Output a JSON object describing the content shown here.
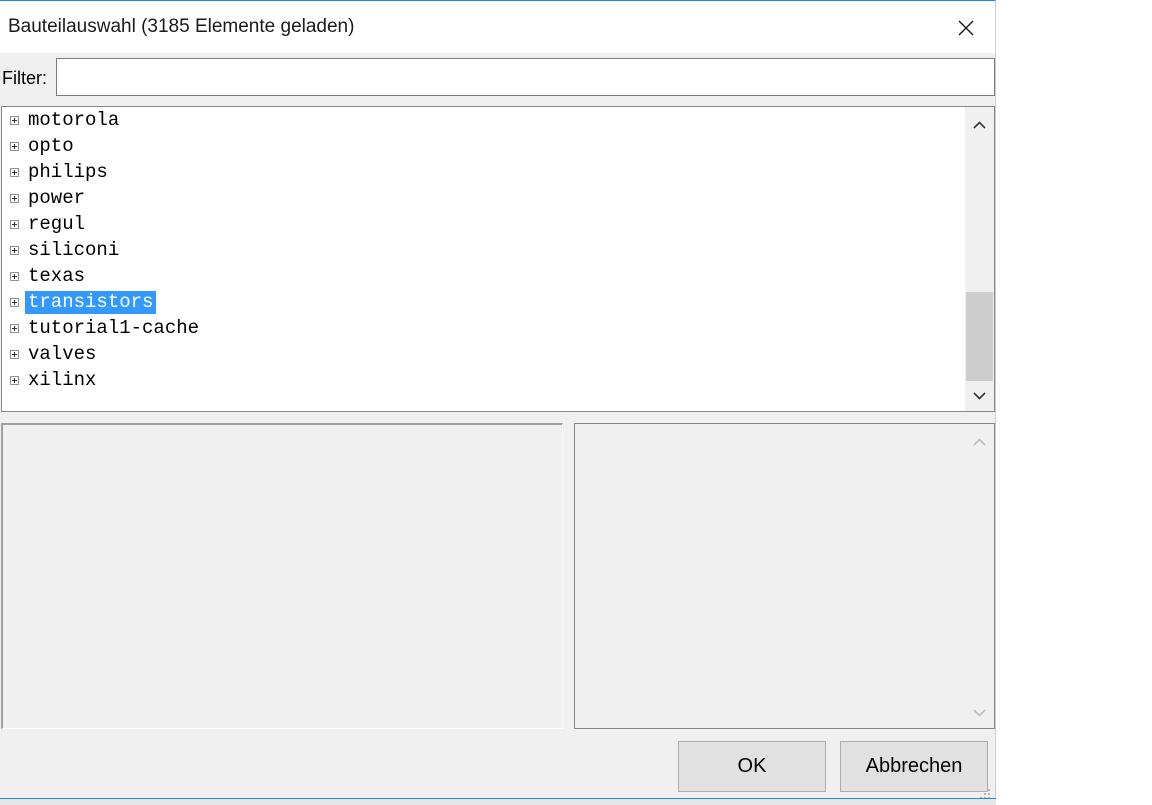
{
  "window": {
    "title": "Bauteilauswahl (3185 Elemente geladen)"
  },
  "filter": {
    "label": "Filter:",
    "value": "",
    "placeholder": ""
  },
  "tree": {
    "items": [
      {
        "label": "motorola",
        "selected": false
      },
      {
        "label": "opto",
        "selected": false
      },
      {
        "label": "philips",
        "selected": false
      },
      {
        "label": "power",
        "selected": false
      },
      {
        "label": "regul",
        "selected": false
      },
      {
        "label": "siliconi",
        "selected": false
      },
      {
        "label": "texas",
        "selected": false
      },
      {
        "label": "transistors",
        "selected": true
      },
      {
        "label": "tutorial1-cache",
        "selected": false
      },
      {
        "label": "valves",
        "selected": false
      },
      {
        "label": "xilinx",
        "selected": false
      }
    ]
  },
  "buttons": {
    "ok_label": "OK",
    "cancel_label": "Abbrechen"
  },
  "icons": {
    "close": "close-icon",
    "expander": "plus-box-icon",
    "scroll_up": "chevron-up-icon",
    "scroll_down": "chevron-down-icon",
    "resize": "resize-grip-icon"
  },
  "colors": {
    "selection": "#3399ff",
    "accent_border": "#1e8bd6",
    "dialog_background": "#f0f0f0"
  }
}
